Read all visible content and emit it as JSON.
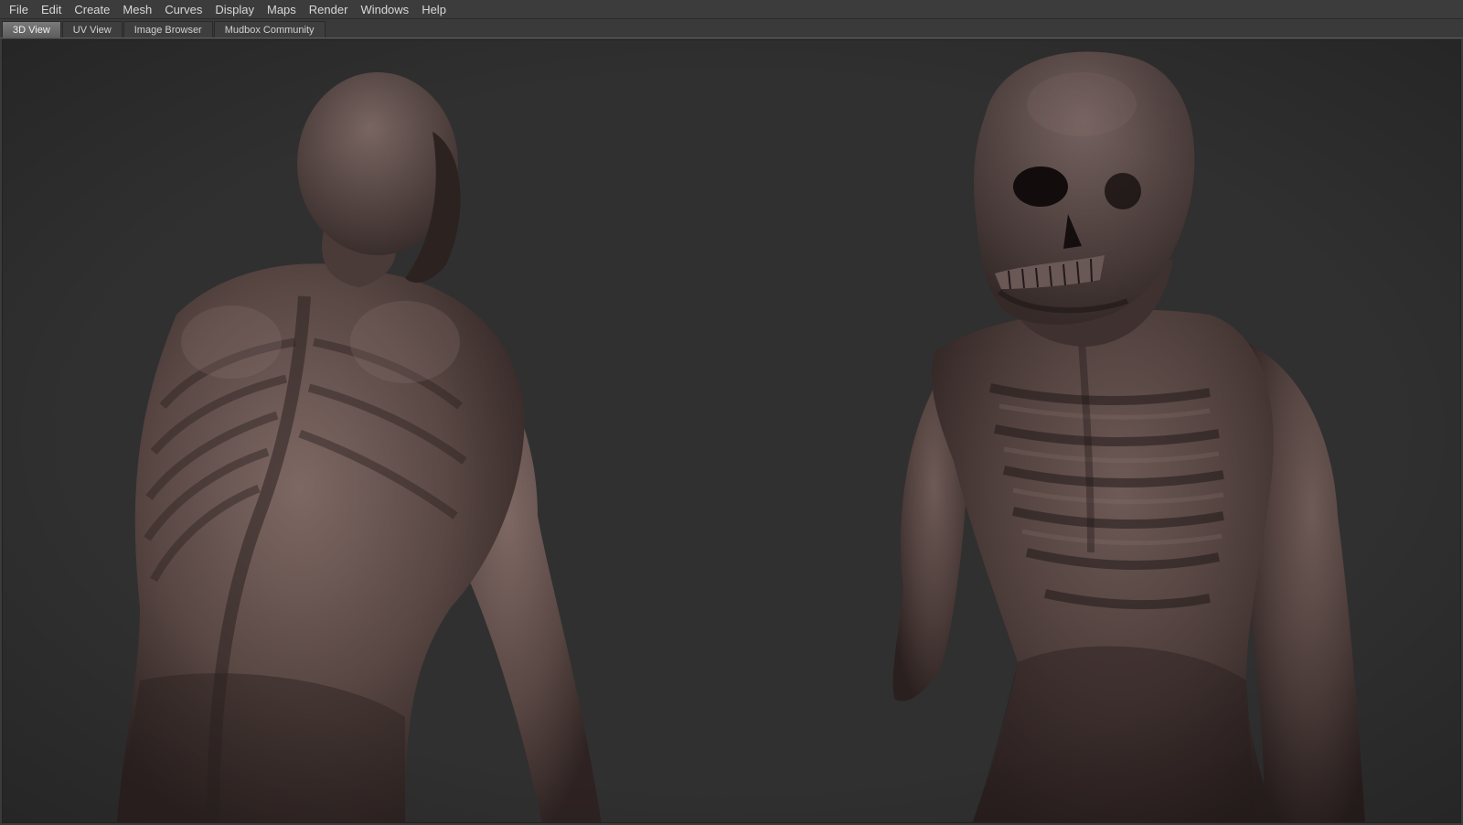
{
  "menubar": {
    "items": [
      {
        "label": "File"
      },
      {
        "label": "Edit"
      },
      {
        "label": "Create"
      },
      {
        "label": "Mesh"
      },
      {
        "label": "Curves"
      },
      {
        "label": "Display"
      },
      {
        "label": "Maps"
      },
      {
        "label": "Render"
      },
      {
        "label": "Windows"
      },
      {
        "label": "Help"
      }
    ]
  },
  "tabs": [
    {
      "label": "3D View",
      "active": true
    },
    {
      "label": "UV View",
      "active": false
    },
    {
      "label": "Image Browser",
      "active": false
    },
    {
      "label": "Mudbox Community",
      "active": false
    }
  ],
  "viewport": {
    "background_color": "#303030",
    "model_color": "#5a4844",
    "model_shadow_color": "#2e2322",
    "model_highlight_color": "#8a7470"
  }
}
